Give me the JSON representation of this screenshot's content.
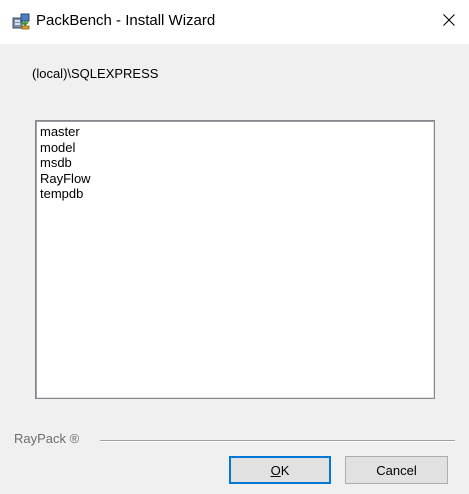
{
  "window": {
    "title": "PackBench - Install Wizard",
    "icons": {
      "app": "installer-icon",
      "close": "close-icon"
    }
  },
  "server": {
    "name": "(local)\\SQLEXPRESS"
  },
  "databases": {
    "items": [
      "master",
      "model",
      "msdb",
      "RayFlow",
      "tempdb"
    ]
  },
  "footer": {
    "brand": "RayPack ®"
  },
  "buttons": {
    "ok_mnemonic": "O",
    "ok_rest": "K",
    "cancel": "Cancel"
  },
  "colors": {
    "accent": "#0078d7",
    "dialog_bg": "#f0f0f0",
    "brand_text": "#6d6d6d"
  }
}
